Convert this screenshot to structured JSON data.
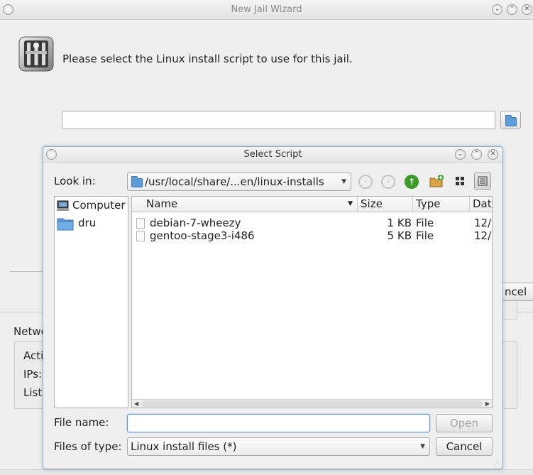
{
  "wizard": {
    "title": "New Jail Wizard",
    "message": "Please select the Linux install script to use for this jail.",
    "path_value": "",
    "cancel_partial": "ncel"
  },
  "main": {
    "network_label": "Netwo",
    "lines": [
      "Acti",
      "IPs:",
      "List"
    ]
  },
  "dialog": {
    "title": "Select Script",
    "look_in_label": "Look in:",
    "look_in_path": "/usr/local/share/...en/linux-installs",
    "sidebar": [
      {
        "label": "Computer",
        "icon": "computer-icon"
      },
      {
        "label": "dru",
        "icon": "folder-icon"
      }
    ],
    "columns": [
      "Name",
      "Size",
      "Type",
      "Dat"
    ],
    "files": [
      {
        "name": "debian-7-wheezy",
        "size": "1 KB",
        "type": "File",
        "date": "12/"
      },
      {
        "name": "gentoo-stage3-i486",
        "size": "5 KB",
        "type": "File",
        "date": "12/"
      }
    ],
    "file_name_label": "File name:",
    "file_name_value": "",
    "files_of_type_label": "Files of type:",
    "files_of_type_value": "Linux install files (*)",
    "open_label": "Open",
    "cancel_label": "Cancel"
  },
  "colors": {
    "accent": "#5b9bd8",
    "focus": "#5a9ad6",
    "nav_up": "#3a9a2a",
    "nav_disabled": "#b5b5b5"
  }
}
